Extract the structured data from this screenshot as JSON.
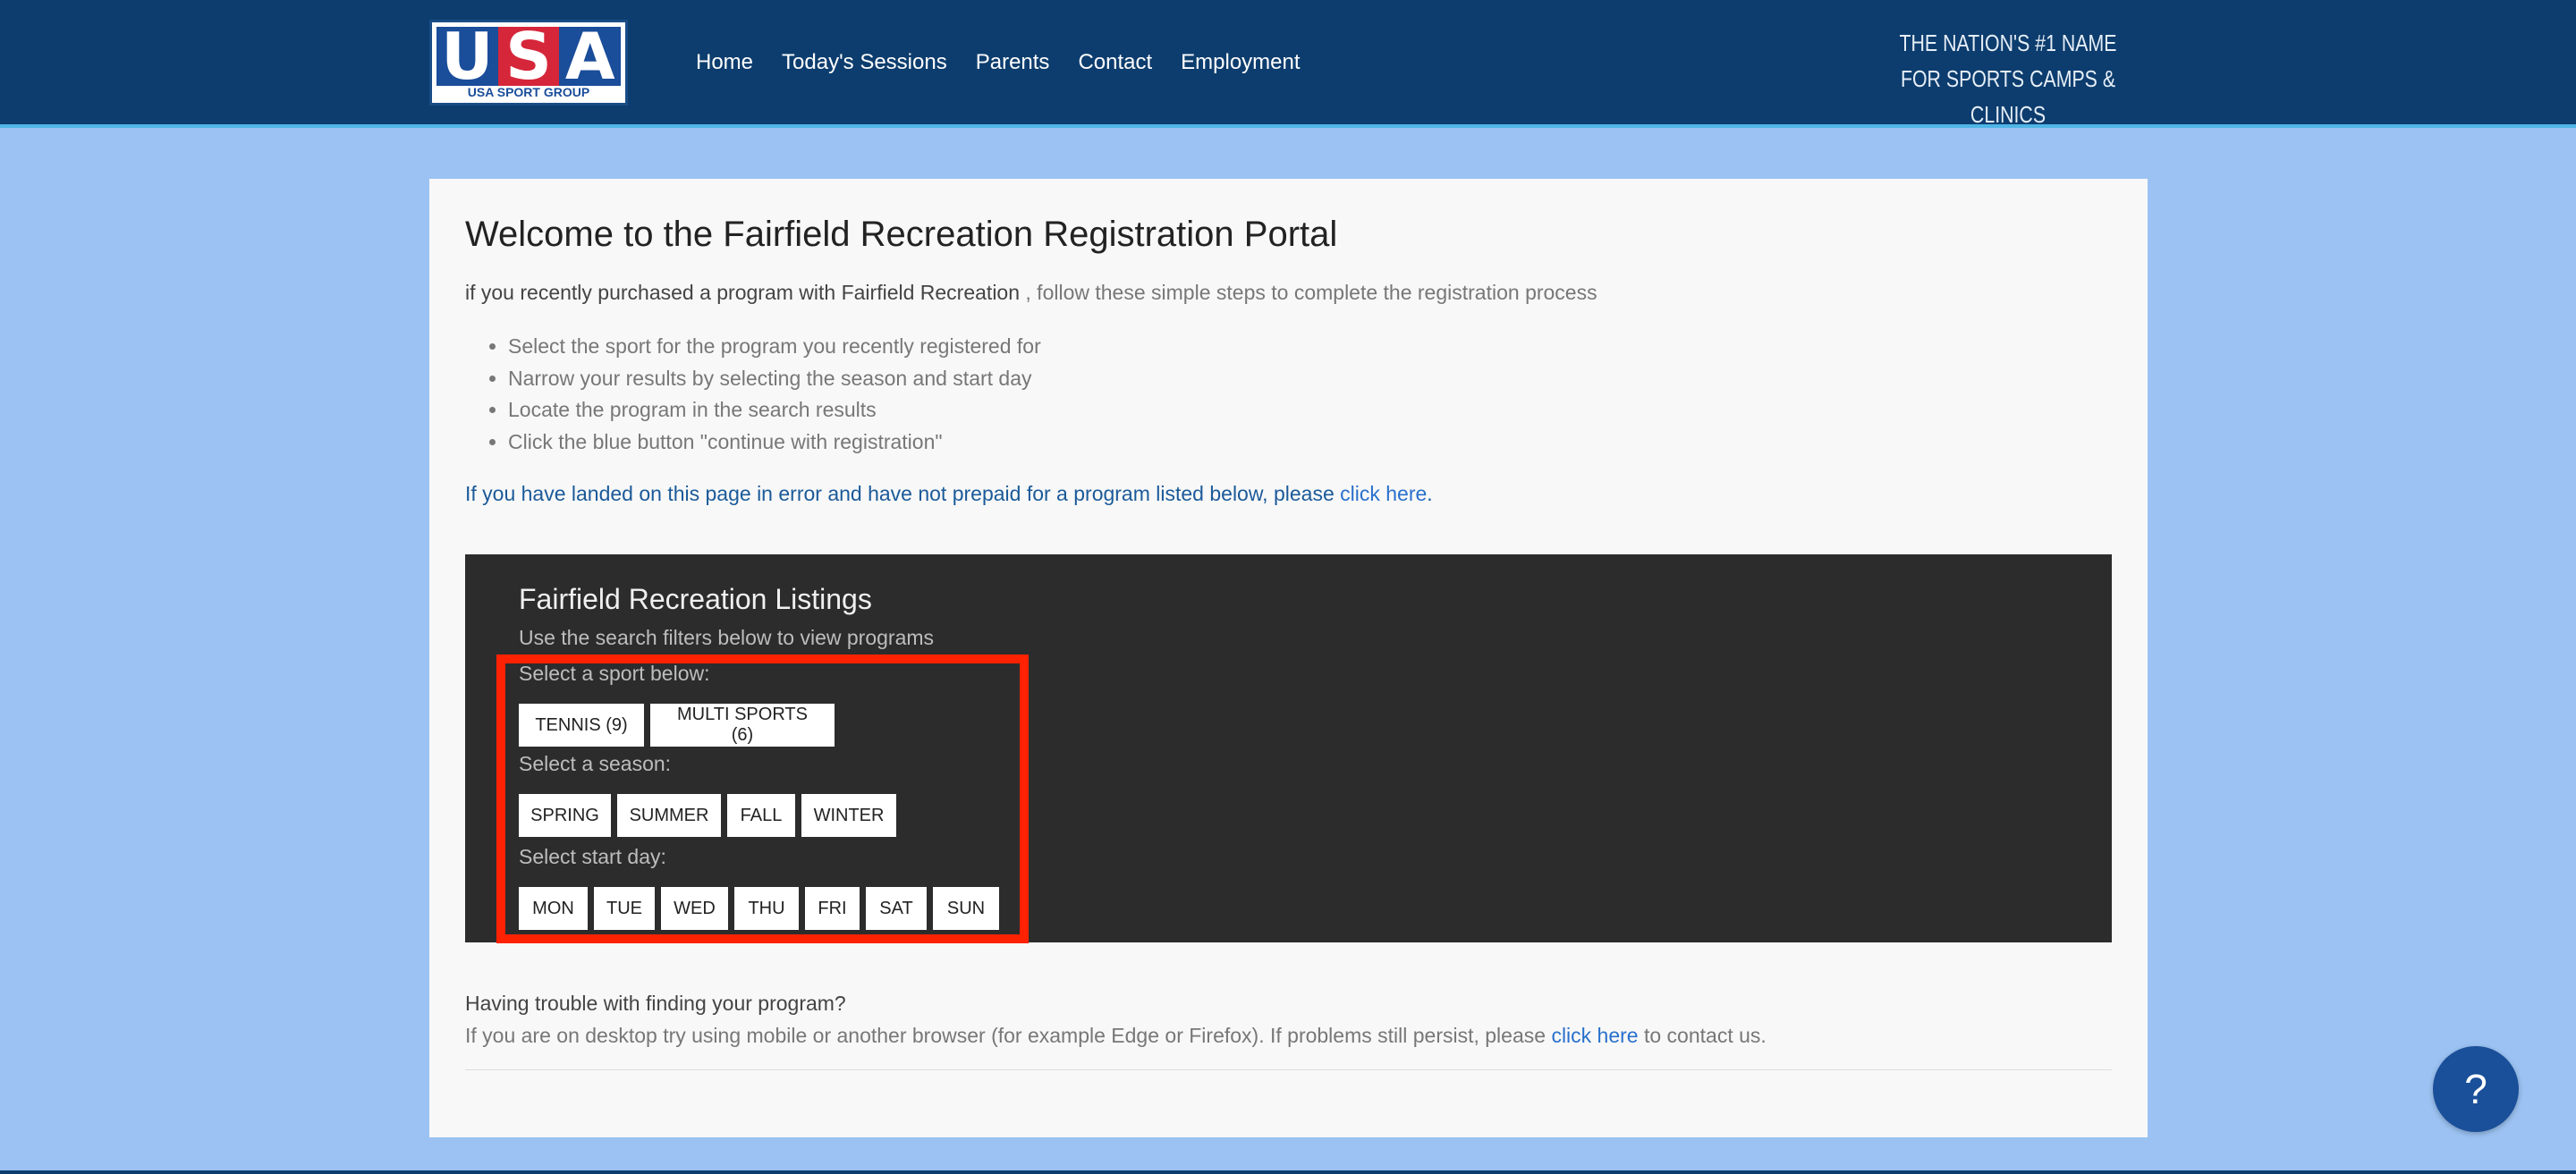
{
  "header": {
    "logo": {
      "letters": [
        "U",
        "S",
        "A"
      ],
      "subtitle": "USA SPORT GROUP"
    },
    "nav": [
      {
        "label": "Home"
      },
      {
        "label": "Today's Sessions"
      },
      {
        "label": "Parents"
      },
      {
        "label": "Contact"
      },
      {
        "label": "Employment"
      }
    ],
    "tagline_line1": "THE NATION'S #1 NAME",
    "tagline_line2": "FOR SPORTS CAMPS & CLINICS"
  },
  "main": {
    "title": "Welcome to the Fairfield Recreation Registration Portal",
    "intro_em": "if you recently purchased a program with Fairfield Recreation",
    "intro_rest": " , follow these simple steps to complete the registration process",
    "steps": [
      "Select the sport for the program you recently registered for",
      "Narrow your results by selecting the season and start day",
      "Locate the program in the search results",
      "Click the blue button \"continue with registration\""
    ],
    "error_text": "If you have landed on this page in error and have not prepaid for a program listed below, please ",
    "error_link": "click here",
    "error_end": "."
  },
  "listings": {
    "title": "Fairfield Recreation Listings",
    "subtitle": "Use the search filters below to view programs",
    "sport_label": "Select a sport below:",
    "sports": [
      "TENNIS (9)",
      "MULTI SPORTS (6)"
    ],
    "season_label": "Select a season:",
    "seasons": [
      "SPRING",
      "SUMMER",
      "FALL",
      "WINTER"
    ],
    "day_label": "Select start day:",
    "days": [
      "MON",
      "TUE",
      "WED",
      "THU",
      "FRI",
      "SAT",
      "SUN"
    ]
  },
  "trouble": {
    "question": "Having trouble with finding your program?",
    "text_before": "If you are on desktop try using mobile or another browser (for example Edge or Firefox). If problems still persist, please ",
    "link": "click here",
    "text_after": " to contact us."
  },
  "help_button": {
    "label": "?"
  },
  "colors": {
    "header_bg": "#0d3d6e",
    "page_bg": "#9bc2f2",
    "panel_bg": "#2c2c2c",
    "highlight": "#ff2200",
    "link": "#2970cc"
  }
}
